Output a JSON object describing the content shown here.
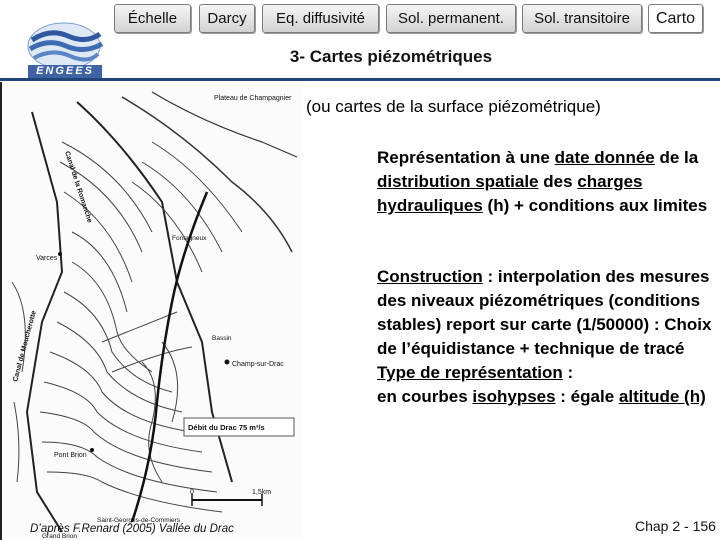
{
  "nav": {
    "tabs": [
      {
        "label": "Échelle",
        "active": false
      },
      {
        "label": "Darcy",
        "active": false
      },
      {
        "label": "Eq. diffusivité",
        "active": false
      },
      {
        "label": "Sol. permanent.",
        "active": false
      },
      {
        "label": "Sol. transitoire",
        "active": false
      },
      {
        "label": "Carto",
        "active": true
      }
    ]
  },
  "logo": {
    "text": "ENGEES"
  },
  "title": "3- Cartes piézométriques",
  "subtitle": "(ou cartes de la surface piézométrique)",
  "paragraph1": {
    "t1": "Représentation à une ",
    "u1": "date donnée",
    "t2": " de la ",
    "u2": "distribution spatiale",
    "t3": " des ",
    "u3": "charges hydrauliques",
    "t4": " (h) + conditions aux limites"
  },
  "paragraph2": {
    "u1": "Construction",
    "t1": " : interpolation des mesures des niveaux piézométriques (conditions stables) report sur carte (1/50000) : Choix de l’équidistance + technique de tracé",
    "u2": "Type de représentation",
    "t2": " :",
    "t3": "en courbes ",
    "u3": "isohypses",
    "t4": " : égale ",
    "u4": "altitude (h)"
  },
  "map": {
    "caption": "D’après F.Renard (2005) Vallée du Drac",
    "labels": {
      "plateau": "Plateau de Champagnier",
      "varces": "Varces",
      "champ": "Champ-sur-Drac",
      "debit": "Débit du Drac 75 m³/s",
      "pont": "Pont Brion",
      "scale0": "0",
      "scale1": "1,5km",
      "grand": "Grand Brion",
      "saint": "Saint-Georges-de-Commiers",
      "canal_1": "Canal de la Romanche",
      "canal_2": "Canal de Moucherotte",
      "fontag": "Fontagneux",
      "bassin": "Bassin"
    }
  },
  "page_number": "Chap 2 - 156"
}
